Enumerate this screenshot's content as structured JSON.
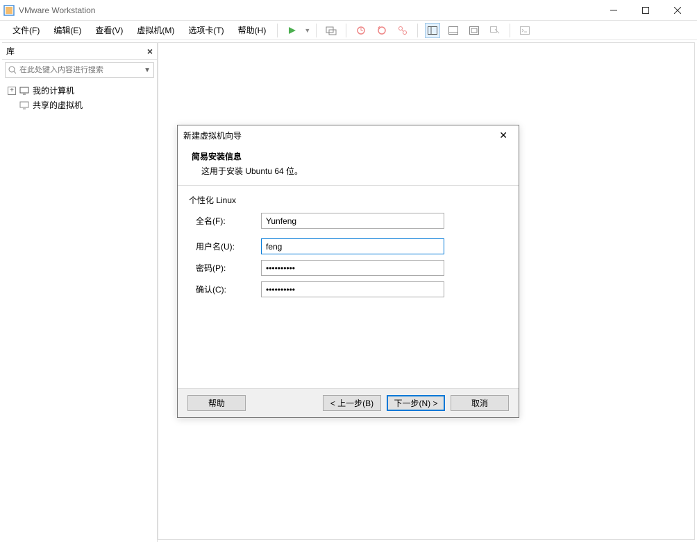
{
  "app": {
    "title": "VMware Workstation"
  },
  "menu": {
    "file": "文件(F)",
    "edit": "编辑(E)",
    "view": "查看(V)",
    "vm": "虚拟机(M)",
    "tabs": "选项卡(T)",
    "help": "帮助(H)"
  },
  "sidebar": {
    "title": "库",
    "search_placeholder": "在此处键入内容进行搜索",
    "tree": {
      "my_computer": "我的计算机",
      "shared_vms": "共享的虚拟机"
    }
  },
  "dialog": {
    "title": "新建虚拟机向导",
    "header_title": "简易安装信息",
    "header_sub": "这用于安装 Ubuntu 64 位。",
    "group": "个性化 Linux",
    "fields": {
      "fullname_label": "全名(F):",
      "fullname_value": "Yunfeng",
      "username_label": "用户名(U):",
      "username_value": "feng",
      "password_label": "密码(P):",
      "password_value": "••••••••••",
      "confirm_label": "确认(C):",
      "confirm_value": "••••••••••"
    },
    "buttons": {
      "help": "帮助",
      "back": "< 上一步(B)",
      "next": "下一步(N) >",
      "cancel": "取消"
    }
  }
}
